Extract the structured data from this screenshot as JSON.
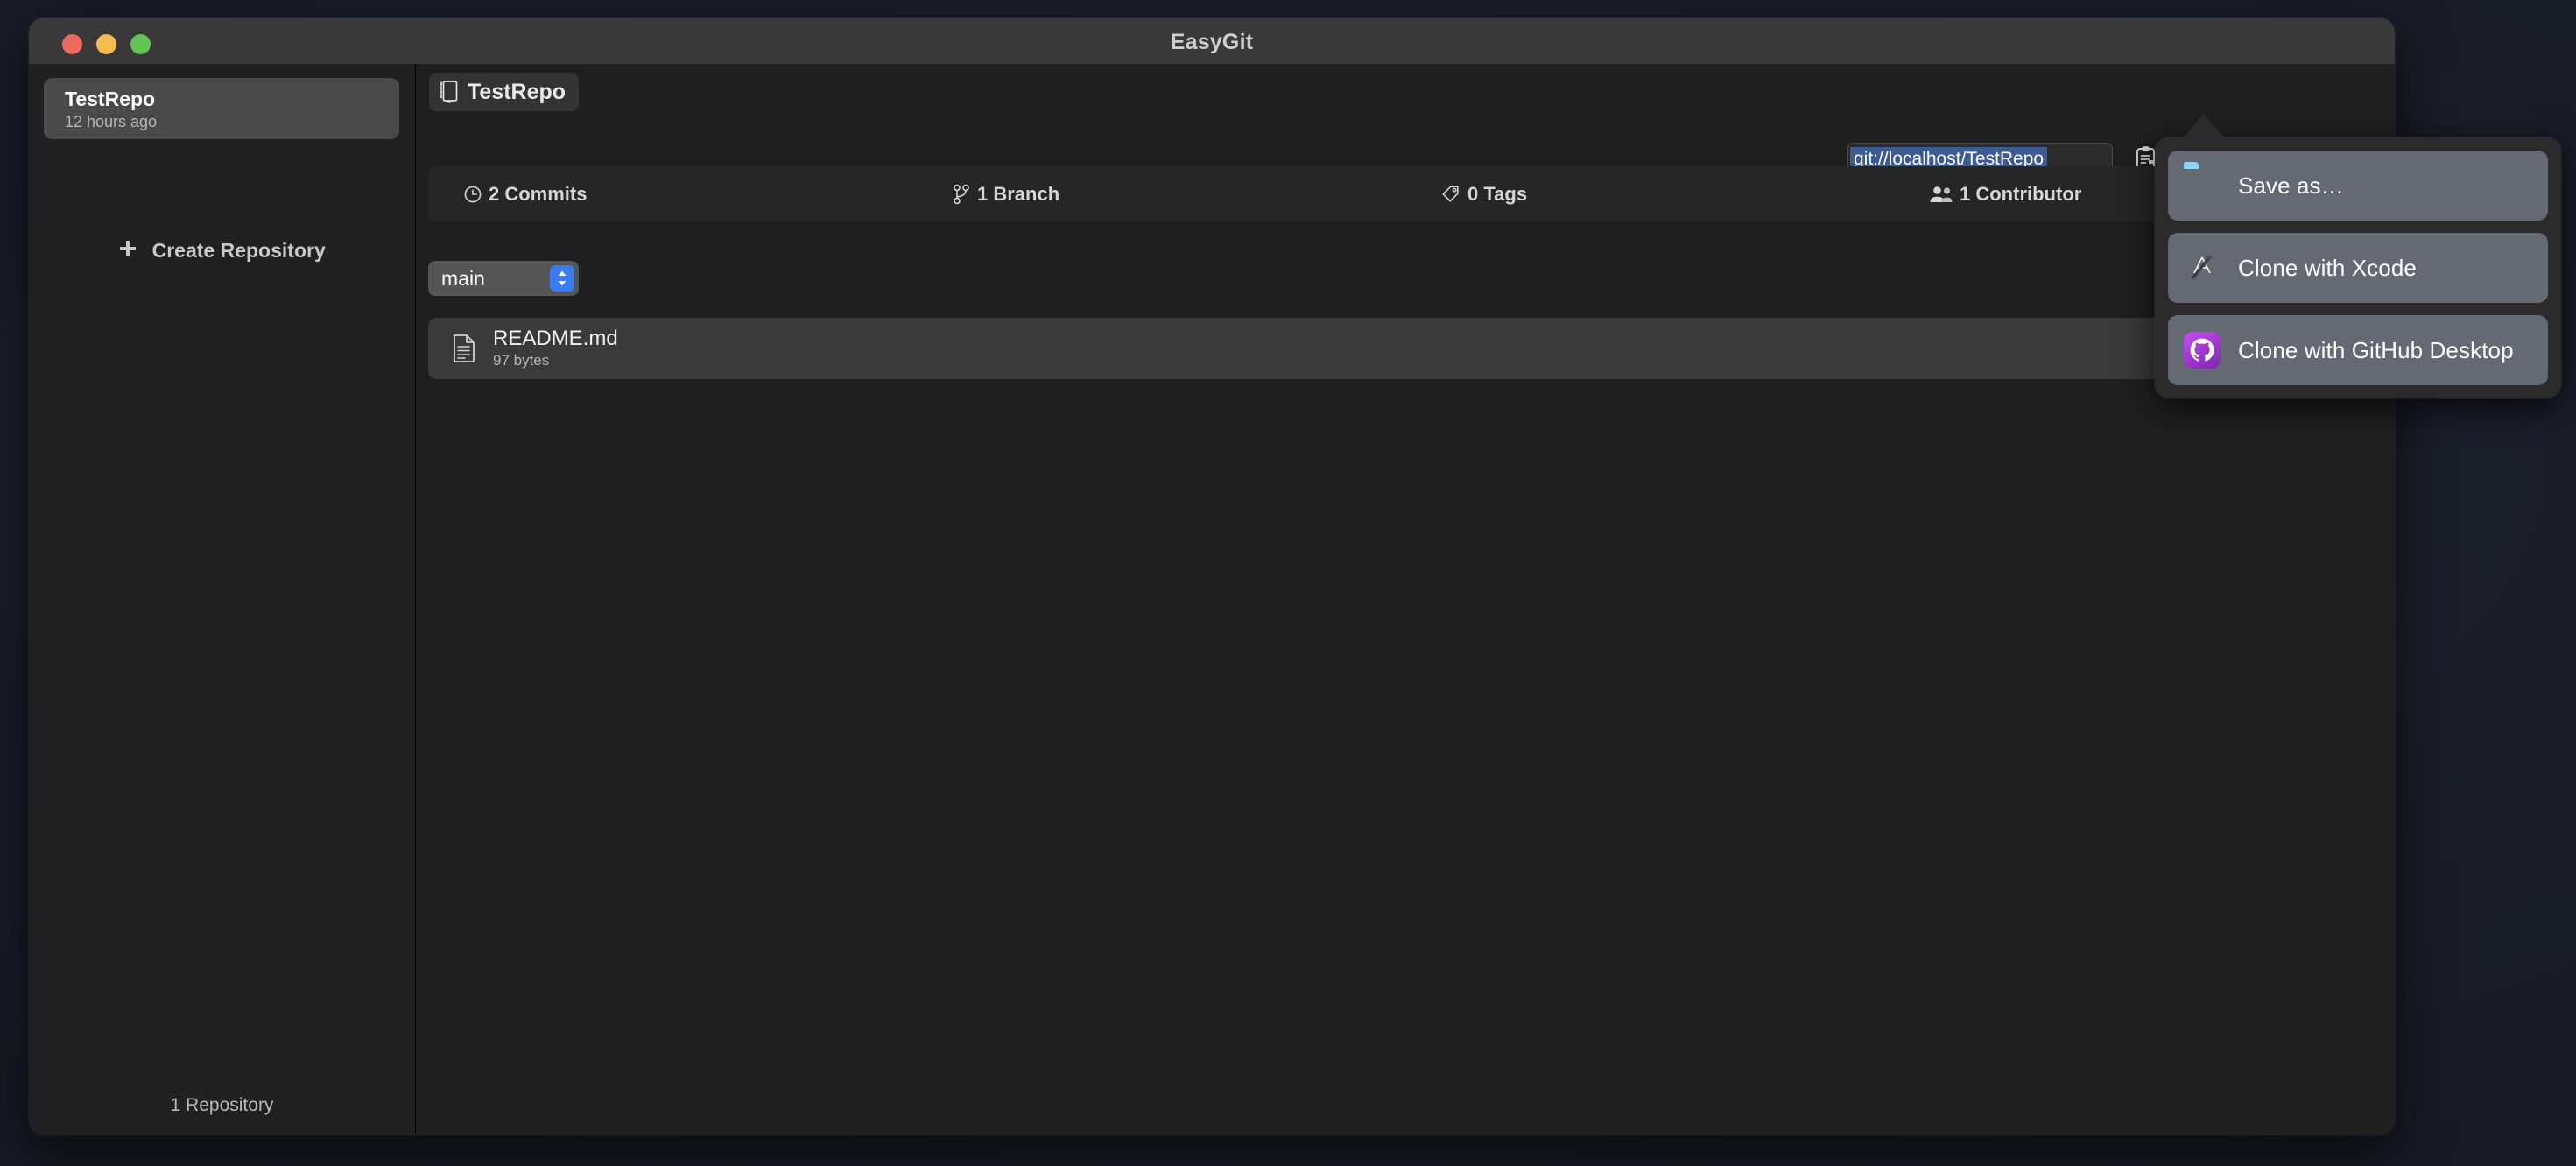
{
  "window": {
    "title": "EasyGit",
    "traffic_lights": [
      {
        "name": "close",
        "color": "#ec6a5f"
      },
      {
        "name": "minimize",
        "color": "#f4bd4f"
      },
      {
        "name": "maximize",
        "color": "#61c454"
      }
    ]
  },
  "sidebar": {
    "repository": {
      "name": "TestRepo",
      "modified": "12 hours ago"
    },
    "create_repository_label": "Create Repository",
    "footer_count": "1 Repository"
  },
  "content": {
    "repo_header": {
      "icon": "book-icon",
      "label": "TestRepo"
    },
    "clone_url": {
      "value": "git://localhost/TestRepo",
      "placeholder": "Clone URL",
      "selected": true,
      "selection_color": "#3c5b94"
    },
    "toolbar": {
      "paste_icon": "clipboard-paste-icon",
      "download_icon": "download-to-computer-icon"
    },
    "stats": [
      {
        "icon": "clock-icon",
        "label": "2 Commits"
      },
      {
        "icon": "branch-icon",
        "label": "1 Branch"
      },
      {
        "icon": "tag-icon",
        "label": "0 Tags"
      },
      {
        "icon": "people-icon",
        "label": "1 Contributor"
      }
    ],
    "branch_selector": {
      "selected": "main",
      "options": [
        "main"
      ]
    },
    "files": [
      {
        "icon": "document-icon",
        "name": "README.md",
        "size": "97 bytes"
      }
    ]
  },
  "popover": {
    "items": [
      {
        "icon": "blue-folder-icon",
        "label": "Save as…"
      },
      {
        "icon": "xcode-app-icon",
        "label": "Clone with Xcode"
      },
      {
        "icon": "github-desktop-icon",
        "label": "Clone with GitHub Desktop"
      }
    ]
  },
  "colors": {
    "accent": "#3a7ced",
    "window_chrome": "#393939",
    "sidebar_bg": "#212121",
    "content_bg": "#1f1f1f",
    "popover_bg": "#2b2b2b",
    "popover_item_bg": "#646973"
  }
}
